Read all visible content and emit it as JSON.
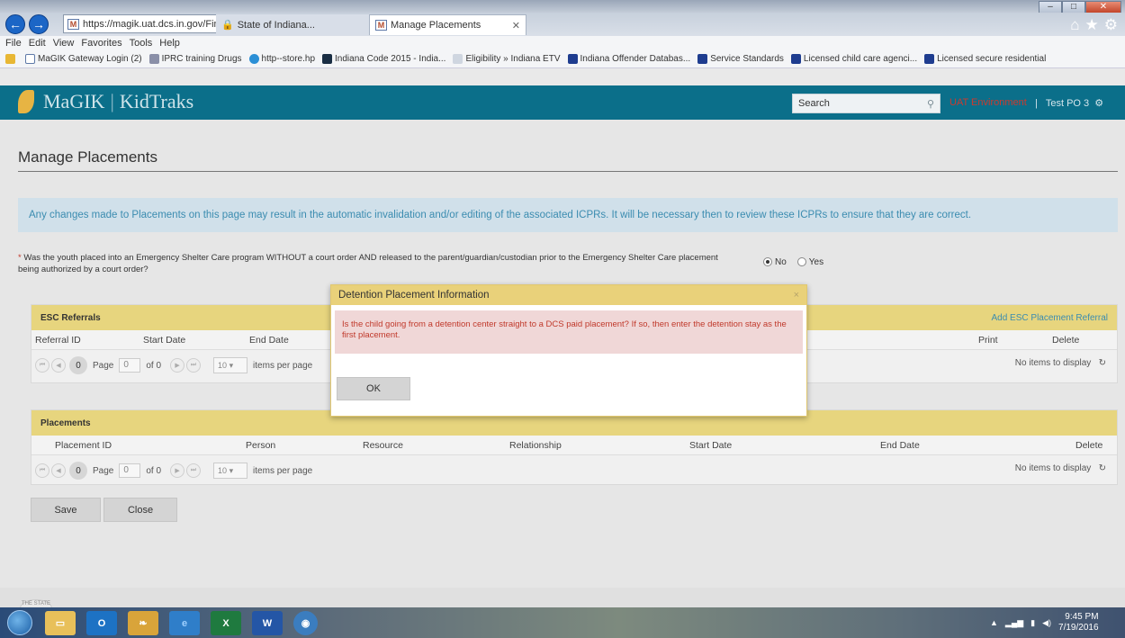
{
  "browser": {
    "address_url": "https://magik.uat.dcs.in.gov/Financials/C",
    "tab1_label": "State of Indiana...",
    "tab2_label": "Manage Placements",
    "menu": [
      "File",
      "Edit",
      "View",
      "Favorites",
      "Tools",
      "Help"
    ],
    "favorites": [
      "MaGIK Gateway Login (2)",
      "IPRC training Drugs",
      "http--store.hp",
      "Indiana Code 2015 - India...",
      "Eligibility » Indiana ETV",
      "Indiana Offender Databas...",
      "Service Standards",
      "Licensed child care agenci...",
      "Licensed secure residential"
    ]
  },
  "header": {
    "brand_left": "MaGIK",
    "brand_right": "KidTraks",
    "search_placeholder": "Search",
    "env_label": "UAT Environment",
    "user_sep": "|",
    "user_label": "Test PO 3"
  },
  "page": {
    "title": "Manage Placements",
    "info_message": "Any changes made to Placements on this page may result in the automatic invalidation and/or editing of the associated ICPRs. It will be necessary then to review these ICPRs to ensure that they are correct.",
    "question_marker": "*",
    "question_text": "Was the youth placed into an Emergency Shelter Care program WITHOUT a court order AND released to the parent/guardian/custodian prior to the Emergency Shelter Care placement being authorized by a court order?",
    "radio_no": "No",
    "radio_yes": "Yes",
    "selected": "No"
  },
  "esc": {
    "title": "ESC Referrals",
    "add_link": "Add ESC Placement Referral",
    "columns": [
      "Referral ID",
      "Start Date",
      "End Date",
      "Print",
      "Delete"
    ],
    "pager": {
      "current": "0",
      "page_label": "Page",
      "page_value": "0",
      "of_label": "of 0",
      "per_page": "10",
      "per_page_label": "items per page",
      "empty": "No items to display"
    }
  },
  "placements": {
    "title": "Placements",
    "columns": [
      "Placement ID",
      "Person",
      "Resource",
      "Relationship",
      "Start Date",
      "End Date",
      "Delete"
    ],
    "pager": {
      "current": "0",
      "page_label": "Page",
      "page_value": "0",
      "of_label": "of 0",
      "per_page": "10",
      "per_page_label": "items per page",
      "empty": "No items to display"
    }
  },
  "actions": {
    "save": "Save",
    "close": "Close"
  },
  "modal": {
    "title": "Detention Placement Information",
    "close_glyph": "×",
    "message": "Is the child going from a detention center straight to a DCS paid placement? If so, then enter the detention stay as the first placement.",
    "ok": "OK"
  },
  "taskbar": {
    "outlook_label": "O",
    "excel_label": "X",
    "word_label": "W",
    "time": "9:45 PM",
    "date": "7/19/2016"
  },
  "footer": {
    "seal_text": "THE STATE OF INDIANA"
  }
}
